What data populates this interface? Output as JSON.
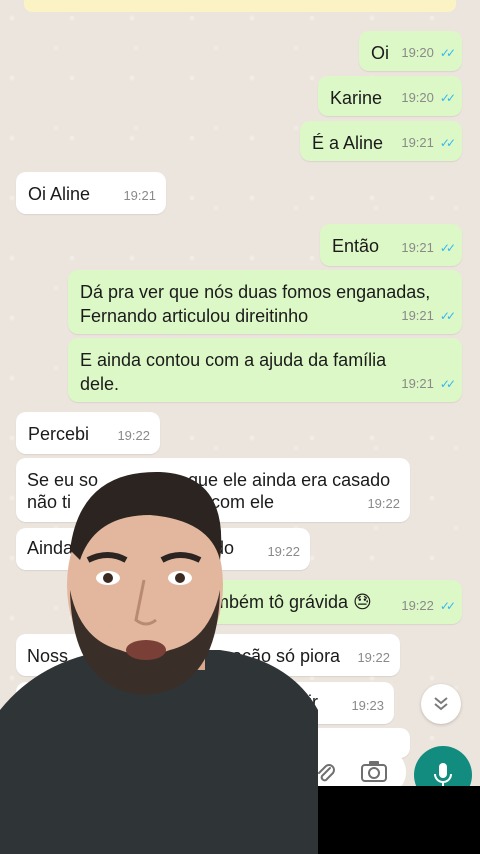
{
  "messages": [
    {
      "dir": "out",
      "lines": [
        "Oi"
      ],
      "time": "19:20",
      "read": true
    },
    {
      "dir": "out",
      "lines": [
        "Karine"
      ],
      "time": "19:20",
      "read": true
    },
    {
      "dir": "out",
      "lines": [
        "É a Aline"
      ],
      "time": "19:21",
      "read": true
    },
    {
      "dir": "in",
      "lines": [
        "Oi Aline"
      ],
      "time": "19:21"
    },
    {
      "dir": "out",
      "lines": [
        "Então"
      ],
      "time": "19:21",
      "read": true
    },
    {
      "dir": "out",
      "lines": [
        "Dá pra ver que nós duas fomos enganadas,",
        "Fernando articulou direitinho"
      ],
      "time": "19:21",
      "read": true
    },
    {
      "dir": "out",
      "lines": [
        "E ainda contou com a ajuda da família",
        "dele."
      ],
      "time": "19:21",
      "read": true
    },
    {
      "dir": "in",
      "lines": [
        "Percebi"
      ],
      "time": "19:22"
    },
    {
      "dir": "in",
      "lines": [
        "Se eu so",
        "que ele ainda era casado",
        "não ti",
        "o com ele"
      ],
      "time": "19:22"
    },
    {
      "dir": "in",
      "lines": [
        "Ainda",
        "do"
      ],
      "time": "19:22"
    },
    {
      "dir": "out",
      "lines": [
        "mbém tô grávida 😓"
      ],
      "time": "19:22",
      "read": true
    },
    {
      "dir": "in",
      "lines": [
        "Noss",
        "ação só piora"
      ],
      "time": "19:22"
    },
    {
      "dir": "in",
      "lines": [
        "se unir"
      ],
      "time": "19:23"
    }
  ],
  "icons": {
    "scroll_down": "chevron-double-down-icon",
    "attach": "paperclip-icon",
    "camera": "camera-icon",
    "mic": "microphone-icon"
  },
  "colors": {
    "outgoing": "#dcf8c6",
    "incoming": "#ffffff",
    "read_ticks": "#34b7f1",
    "mic_button": "#128c7e"
  }
}
